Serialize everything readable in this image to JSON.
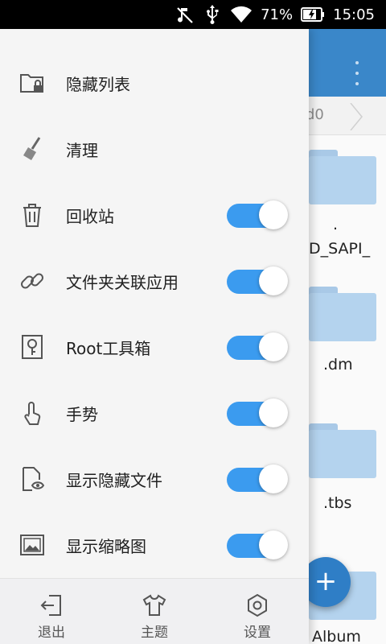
{
  "status_bar": {
    "battery_percent": "71%",
    "time": "15:05"
  },
  "background_app": {
    "breadcrumb_text": "d0",
    "items": [
      {
        "label": "."
      },
      {
        "label": "D_SAPI_"
      },
      {
        "label": ".dm"
      },
      {
        "label": ".tbs"
      },
      {
        "label": "Album"
      }
    ],
    "fab_icon": "plus-icon"
  },
  "drawer": {
    "menu": [
      {
        "label": "隐藏列表",
        "icon": "hidden-folder-icon",
        "has_toggle": false
      },
      {
        "label": "清理",
        "icon": "broom-icon",
        "has_toggle": false
      },
      {
        "label": "回收站",
        "icon": "trash-icon",
        "has_toggle": true,
        "enabled": true
      },
      {
        "label": "文件夹关联应用",
        "icon": "link-icon",
        "has_toggle": true,
        "enabled": true
      },
      {
        "label": "Root工具箱",
        "icon": "root-key-icon",
        "has_toggle": true,
        "enabled": true
      },
      {
        "label": "手势",
        "icon": "gesture-icon",
        "has_toggle": true,
        "enabled": true
      },
      {
        "label": "显示隐藏文件",
        "icon": "file-eye-icon",
        "has_toggle": true,
        "enabled": true
      },
      {
        "label": "显示缩略图",
        "icon": "thumbnail-icon",
        "has_toggle": true,
        "enabled": true
      }
    ],
    "footer": [
      {
        "label": "退出",
        "icon": "exit-icon"
      },
      {
        "label": "主题",
        "icon": "shirt-icon"
      },
      {
        "label": "设置",
        "icon": "gear-icon"
      }
    ]
  },
  "colors": {
    "toggle_on": "#3b9bef",
    "toolbar": "#3a87c9",
    "folder": "#b4d3ee"
  }
}
